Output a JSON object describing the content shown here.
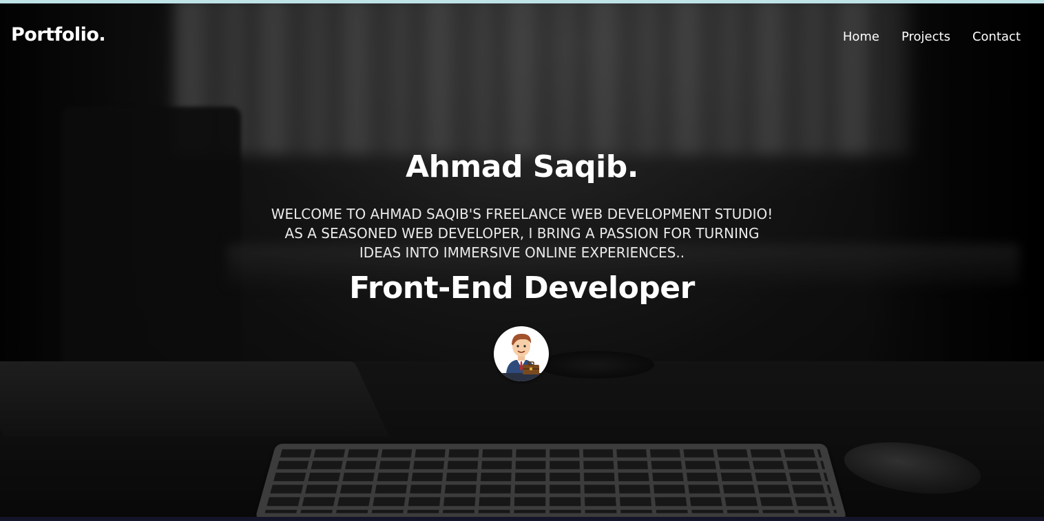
{
  "nav": {
    "logo": "Portfolio.",
    "links": [
      "Home",
      "Projects",
      "Contact"
    ]
  },
  "hero": {
    "name": "Ahmad Saqib.",
    "intro_lines": [
      "WELCOME TO AHMAD SAQIB'S FREELANCE WEB DEVELOPMENT STUDIO!",
      "AS A SEASONED WEB DEVELOPER, I BRING A PASSION FOR TURNING",
      "IDEAS INTO IMMERSIVE ONLINE EXPERIENCES.."
    ],
    "role": "Front-End Developer",
    "avatar_icon": "businessman-avatar-icon"
  },
  "colors": {
    "top_accent": "#bfe3e6",
    "text": "#ffffff"
  }
}
